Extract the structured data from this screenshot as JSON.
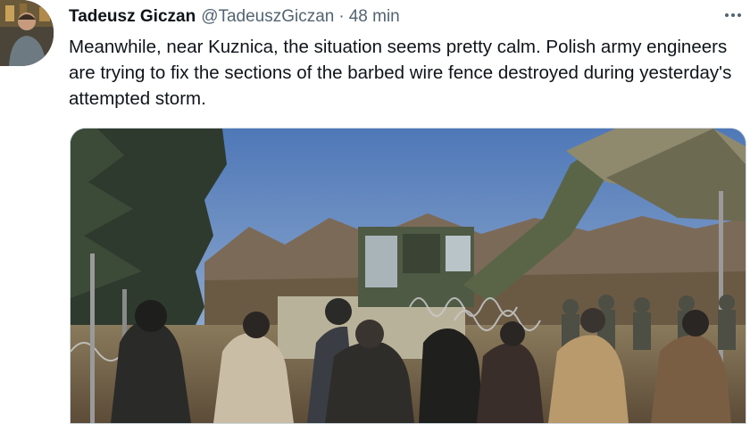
{
  "tweet": {
    "author_name": "Tadeusz Giczan",
    "author_handle": "@TadeuszGiczan",
    "separator": "·",
    "time_ago": "48 min",
    "text": "Meanwhile, near Kuznica, the situation seems pretty calm. Polish army engineers are trying to fix the sections of the barbed wire fence destroyed during yesterday's attempted storm."
  },
  "icons": {
    "more": "more-horizontal-icon"
  },
  "colors": {
    "text_primary": "#0f1419",
    "text_secondary": "#536471",
    "media_border": "#cfd9de"
  }
}
